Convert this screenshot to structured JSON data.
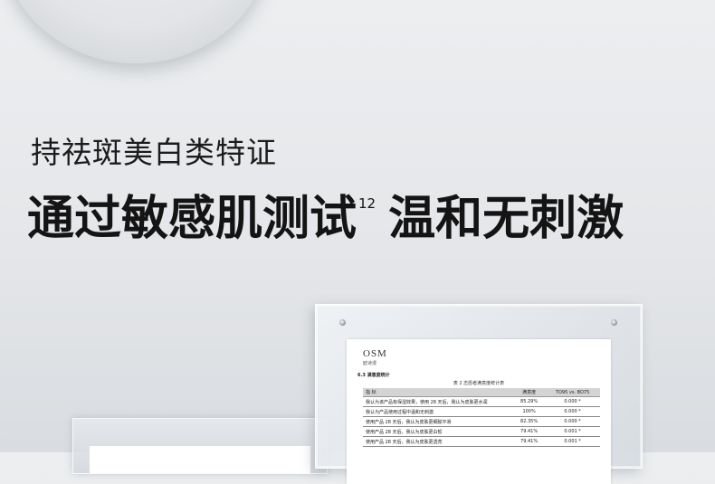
{
  "heading": {
    "subtitle": "持祛斑美白类特证",
    "main_part1": "通过敏感肌测试",
    "superscript": "12",
    "main_part2": "温和无刺激"
  },
  "document": {
    "logo": "OSM",
    "logo_sub": "欧诗漫",
    "section": "6.3  满意度统计",
    "table_caption": "表 2  志愿者满意度统计表",
    "columns": [
      "指        标",
      "满意度",
      "TO95 vs. BO75"
    ],
    "rows": [
      [
        "我认为该产品有保湿效果，使用 28 天后，我认为皮肤更水润",
        "85.29%",
        "0.000 *"
      ],
      [
        "我认为产品使用过程中温和无刺激",
        "100%",
        "0.000 *"
      ],
      [
        "使用产品 28 天后，我认为皮肤更细腻平滑",
        "82.35%",
        "0.000 *"
      ],
      [
        "使用产品 28 天后，我认为皮肤更白皙",
        "79.41%",
        "0.001 *"
      ],
      [
        "使用产品 28 天后，我认为皮肤更透亮",
        "79.41%",
        "0.001 *"
      ]
    ]
  }
}
